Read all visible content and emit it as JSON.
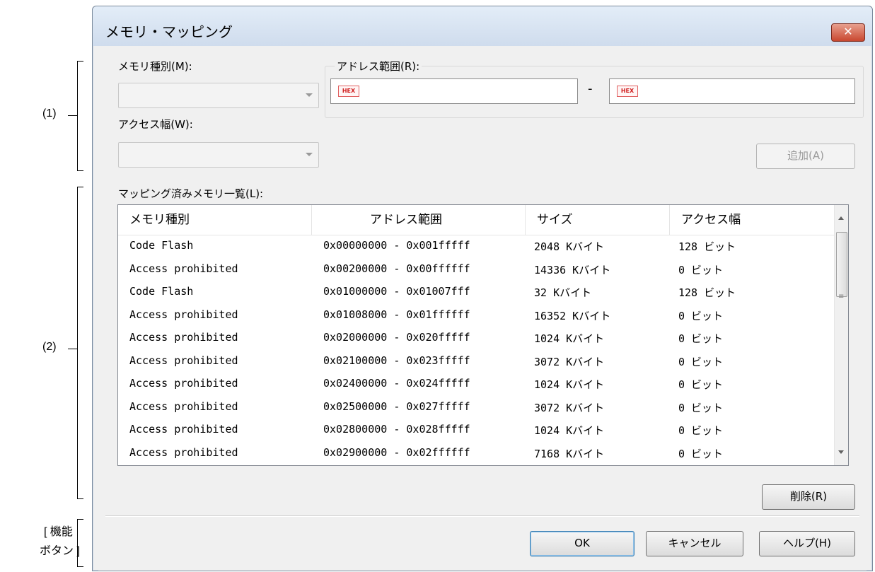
{
  "annotations": {
    "label1": "(1)",
    "label2": "(2)",
    "label3_line1": "[ 機能",
    "label3_line2": "ボタン ]"
  },
  "dialog": {
    "title": "メモリ・マッピング",
    "close_label": "✕"
  },
  "settings": {
    "memory_type_label": "メモリ種別(M):",
    "memory_type_value": "",
    "address_range_label": "アドレス範囲(R):",
    "address_start_value": "",
    "address_end_value": "",
    "hex_badge": "HEX",
    "range_separator": "-",
    "access_width_label": "アクセス幅(W):",
    "access_width_value": "",
    "add_button": "追加(A)"
  },
  "mapped_list": {
    "label": "マッピング済みメモリ一覧(L):",
    "columns": [
      "メモリ種別",
      "アドレス範囲",
      "サイズ",
      "アクセス幅"
    ],
    "rows": [
      [
        "Code Flash",
        "0x00000000 - 0x001fffff",
        "2048 Kバイト",
        "128 ビット"
      ],
      [
        "Access prohibited",
        "0x00200000 - 0x00ffffff",
        "14336 Kバイト",
        "0 ビット"
      ],
      [
        "Code Flash",
        "0x01000000 - 0x01007fff",
        "32 Kバイト",
        "128 ビット"
      ],
      [
        "Access prohibited",
        "0x01008000 - 0x01ffffff",
        "16352 Kバイト",
        "0 ビット"
      ],
      [
        "Access prohibited",
        "0x02000000 - 0x020fffff",
        "1024 Kバイト",
        "0 ビット"
      ],
      [
        "Access prohibited",
        "0x02100000 - 0x023fffff",
        "3072 Kバイト",
        "0 ビット"
      ],
      [
        "Access prohibited",
        "0x02400000 - 0x024fffff",
        "1024 Kバイト",
        "0 ビット"
      ],
      [
        "Access prohibited",
        "0x02500000 - 0x027fffff",
        "3072 Kバイト",
        "0 ビット"
      ],
      [
        "Access prohibited",
        "0x02800000 - 0x028fffff",
        "1024 Kバイト",
        "0 ビット"
      ],
      [
        "Access prohibited",
        "0x02900000 - 0x02ffffff",
        "7168 Kバイト",
        "0 ビット"
      ]
    ],
    "delete_button": "削除(R)",
    "scroll_grip": "≡"
  },
  "footer": {
    "ok_button": "OK",
    "cancel_button": "キャンセル",
    "help_button": "ヘルプ(H)"
  }
}
